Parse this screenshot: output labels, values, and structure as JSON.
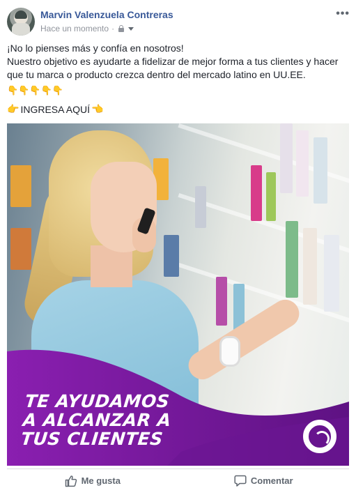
{
  "post": {
    "author": "Marvin Valenzuela Contreras",
    "timestamp": "Hace un momento",
    "separator": "·",
    "privacy_icon": "lock-icon",
    "audience_icon": "caret-down-icon",
    "more_icon": "•••",
    "text_lines": [
      "¡No lo pienses más y confía en nosotros!",
      "Nuestro objetivo es ayudarte a fidelizar de mejor forma a tus clientes y hacer que tu marca o producto crezca dentro del mercado latino en UU.EE."
    ],
    "pointing_down_emojis": "👇👇👇👇👇",
    "cta_text": "INGRESA AQUÍ",
    "cta_left_emoji": "👉",
    "cta_right_emoji": "👈"
  },
  "image": {
    "slogan_lines": [
      "TE AYUDAMOS",
      "A ALCANZAR A",
      "TUS CLIENTES"
    ],
    "accent_color": "#8a1fb0",
    "accent_color_dark": "#5e1283"
  },
  "actions": {
    "like_label": "Me gusta",
    "comment_label": "Comentar"
  }
}
